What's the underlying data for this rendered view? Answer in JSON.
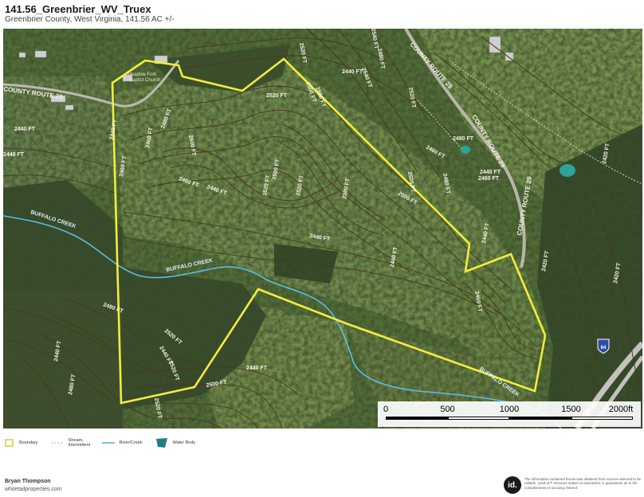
{
  "header": {
    "title": "141.56_Greenbrier_WV_Truex",
    "subtitle": "Greenbrier County, West Virginia, 141.56 AC +/-"
  },
  "map": {
    "road_labels": [
      "COUNTY ROUTE 29",
      "COUNTY ROUTE 29",
      "COUNTY ROUTE 29",
      "COUNTY ROUTE 29"
    ],
    "creek_labels": [
      "BUFFALO CREEK",
      "BUFFALO CREEK",
      "BUFFALO CREEK"
    ],
    "place_labels": [
      "Meadow Fork",
      "Baptist Church"
    ],
    "contour_labels": [
      "2520 FT",
      "2500 FT",
      "2520 FT",
      "2560 FT",
      "2540 FT",
      "2520 FT",
      "2480 FT",
      "2460 FT",
      "2500 FT",
      "2460 FT",
      "2440 FT",
      "2440 FT",
      "2440 FT",
      "2440 FT",
      "2460 FT",
      "2500 FT",
      "2520 FT",
      "2520 FT",
      "2500 FT",
      "2500 FT",
      "2520 FT",
      "2480 FT",
      "2460 FT",
      "2440 FT",
      "2420 FT",
      "2440 FT",
      "2440 FT",
      "2460 FT",
      "2480 FT",
      "2520 FT",
      "2440 FT",
      "2440 FT",
      "2440 FT",
      "2480 FT",
      "2520 FT",
      "2520 FT",
      "2500 FT",
      "2440 FT",
      "2420 FT",
      "2420 FT",
      "2480 FT",
      "2460 FT",
      "2440 FT",
      "2480 FT",
      "2540 FT"
    ],
    "highway_shield": "64",
    "colors": {
      "boundary": "#f2ee3a",
      "contour": "#4a3a1c",
      "contour_label": "#f5f1e6",
      "creek": "#5fbde6",
      "water": "#2ea39a"
    }
  },
  "scalebar": {
    "ticks": [
      "0",
      "500",
      "1000",
      "1500",
      "2000ft"
    ]
  },
  "legend": [
    {
      "icon": "boundary-icon",
      "label": "Boundary"
    },
    {
      "icon": "stream-icon",
      "label": "Stream, Intermittent"
    },
    {
      "icon": "river-icon",
      "label": "River/Creek"
    },
    {
      "icon": "water-body-icon",
      "label": "Water Body"
    }
  ],
  "footer": {
    "agent_name": "Bryan Thompson",
    "website": "whitetailproperties.com",
    "logo_text": "id.",
    "disclaimer": "The information contained herein was obtained from sources deemed to be reliable. Land id™ Services makes no warranties or guarantees as to the completeness or accuracy thereof."
  }
}
